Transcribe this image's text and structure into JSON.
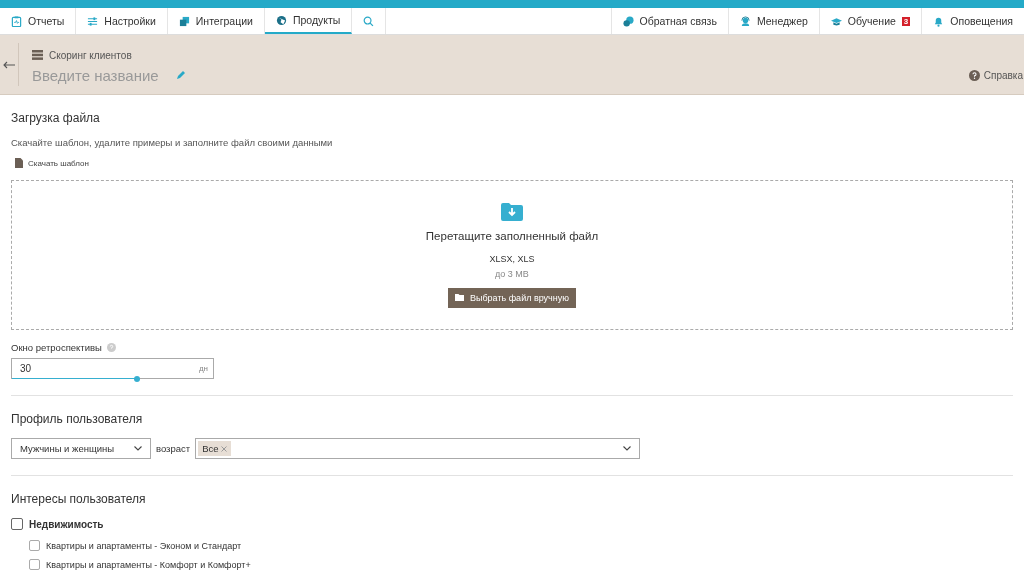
{
  "nav": {
    "tabs": [
      {
        "label": "Отчеты",
        "selected": false
      },
      {
        "label": "Настройки",
        "selected": false
      },
      {
        "label": "Интеграции",
        "selected": false
      },
      {
        "label": "Продукты",
        "selected": true
      }
    ],
    "right": [
      {
        "label": "Обратная связь"
      },
      {
        "label": "Менеджер"
      },
      {
        "label": "Обучение",
        "badge": "3"
      },
      {
        "label": "Оповещения"
      }
    ]
  },
  "header": {
    "breadcrumb": "Скоринг клиентов",
    "title_placeholder": "Введите название",
    "help": "Справка"
  },
  "upload": {
    "title": "Загрузка файла",
    "hint": "Скачайте шаблон, удалите примеры и заполните файл своими данными",
    "template_link": "Скачать шаблон",
    "drop_title": "Перетащите заполненный файл",
    "formats": "XLSX, XLS",
    "size_limit": "до 3 MB",
    "choose_button": "Выбрать файл вручную"
  },
  "retrospective": {
    "label": "Окно ретроспективы",
    "value": "30",
    "unit": "дн",
    "level": 0.62
  },
  "profile": {
    "title": "Профиль пользователя",
    "gender": "Мужчины и женщины",
    "age_label": "возраст",
    "age_tags": [
      "Все"
    ]
  },
  "interests": {
    "title": "Интересы пользователя",
    "groups": [
      {
        "label": "Недвижимость",
        "checked": false,
        "children": [
          {
            "label": "Квартиры и апартаменты - Эконом и Стандарт",
            "checked": false
          },
          {
            "label": "Квартиры и апартаменты - Комфорт и Комфорт+",
            "checked": false
          }
        ]
      }
    ]
  }
}
